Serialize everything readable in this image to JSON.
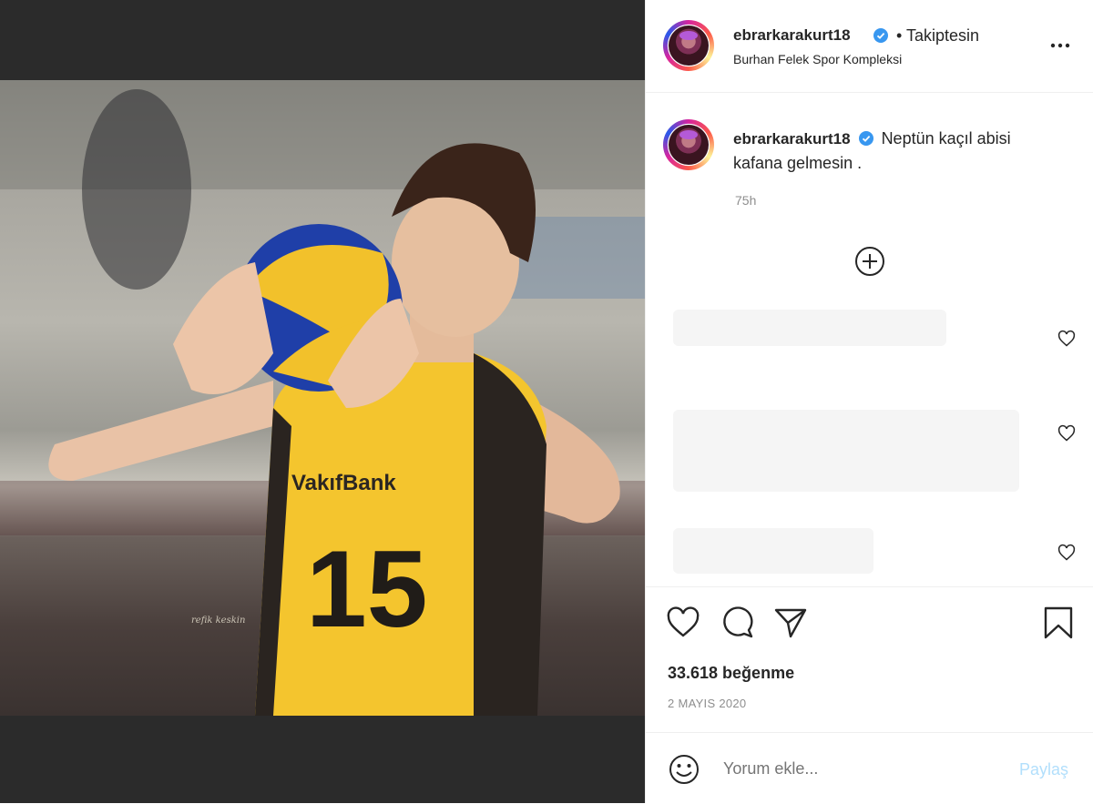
{
  "post": {
    "username": "ebrarkarakurt18",
    "follow_status": "• Takiptesin",
    "location": "Burhan Felek Spor Kompleksi",
    "caption_user": "ebrarkarakurt18",
    "caption_text": "Neptün kaçıl abisi kafana gelmesin .",
    "time_ago": "75h",
    "likes": "33.618 beğenme",
    "date": "2 MAYIS 2020",
    "photo_watermark": "refik keskin",
    "jersey_number": "15",
    "jersey_sponsor": "VakıfBank"
  },
  "comment_box": {
    "placeholder": "Yorum ekle...",
    "share_label": "Paylaş"
  },
  "icons": [
    "more-icon",
    "verified-icon",
    "add-comment-icon",
    "heart-icon",
    "comment-icon",
    "share-icon",
    "bookmark-icon",
    "emoji-icon"
  ],
  "colors": {
    "verified": "#3897f0",
    "share_disabled": "#b2dffc",
    "muted_text": "#8e8e8e"
  }
}
